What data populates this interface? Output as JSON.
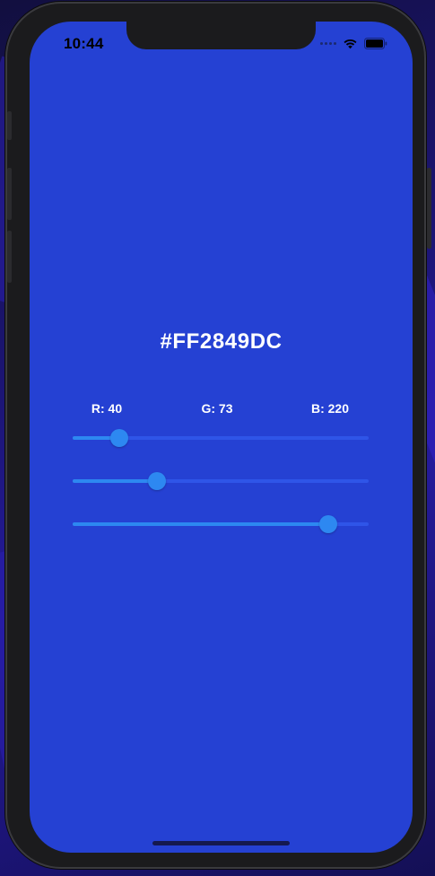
{
  "status_bar": {
    "time": "10:44",
    "icons": [
      "cellular-signal-icon",
      "wifi-icon",
      "battery-icon"
    ]
  },
  "color_picker": {
    "hex_label": "#FF2849DC",
    "background_color": "#2541D3",
    "channels": [
      {
        "id": "r",
        "label": "R: 40",
        "value": 40,
        "max": 255
      },
      {
        "id": "g",
        "label": "G: 73",
        "value": 73,
        "max": 255
      },
      {
        "id": "b",
        "label": "B: 220",
        "value": 220,
        "max": 255
      }
    ],
    "slider_active_color": "#2D88F1",
    "slider_track_color": "#2F55E8"
  }
}
